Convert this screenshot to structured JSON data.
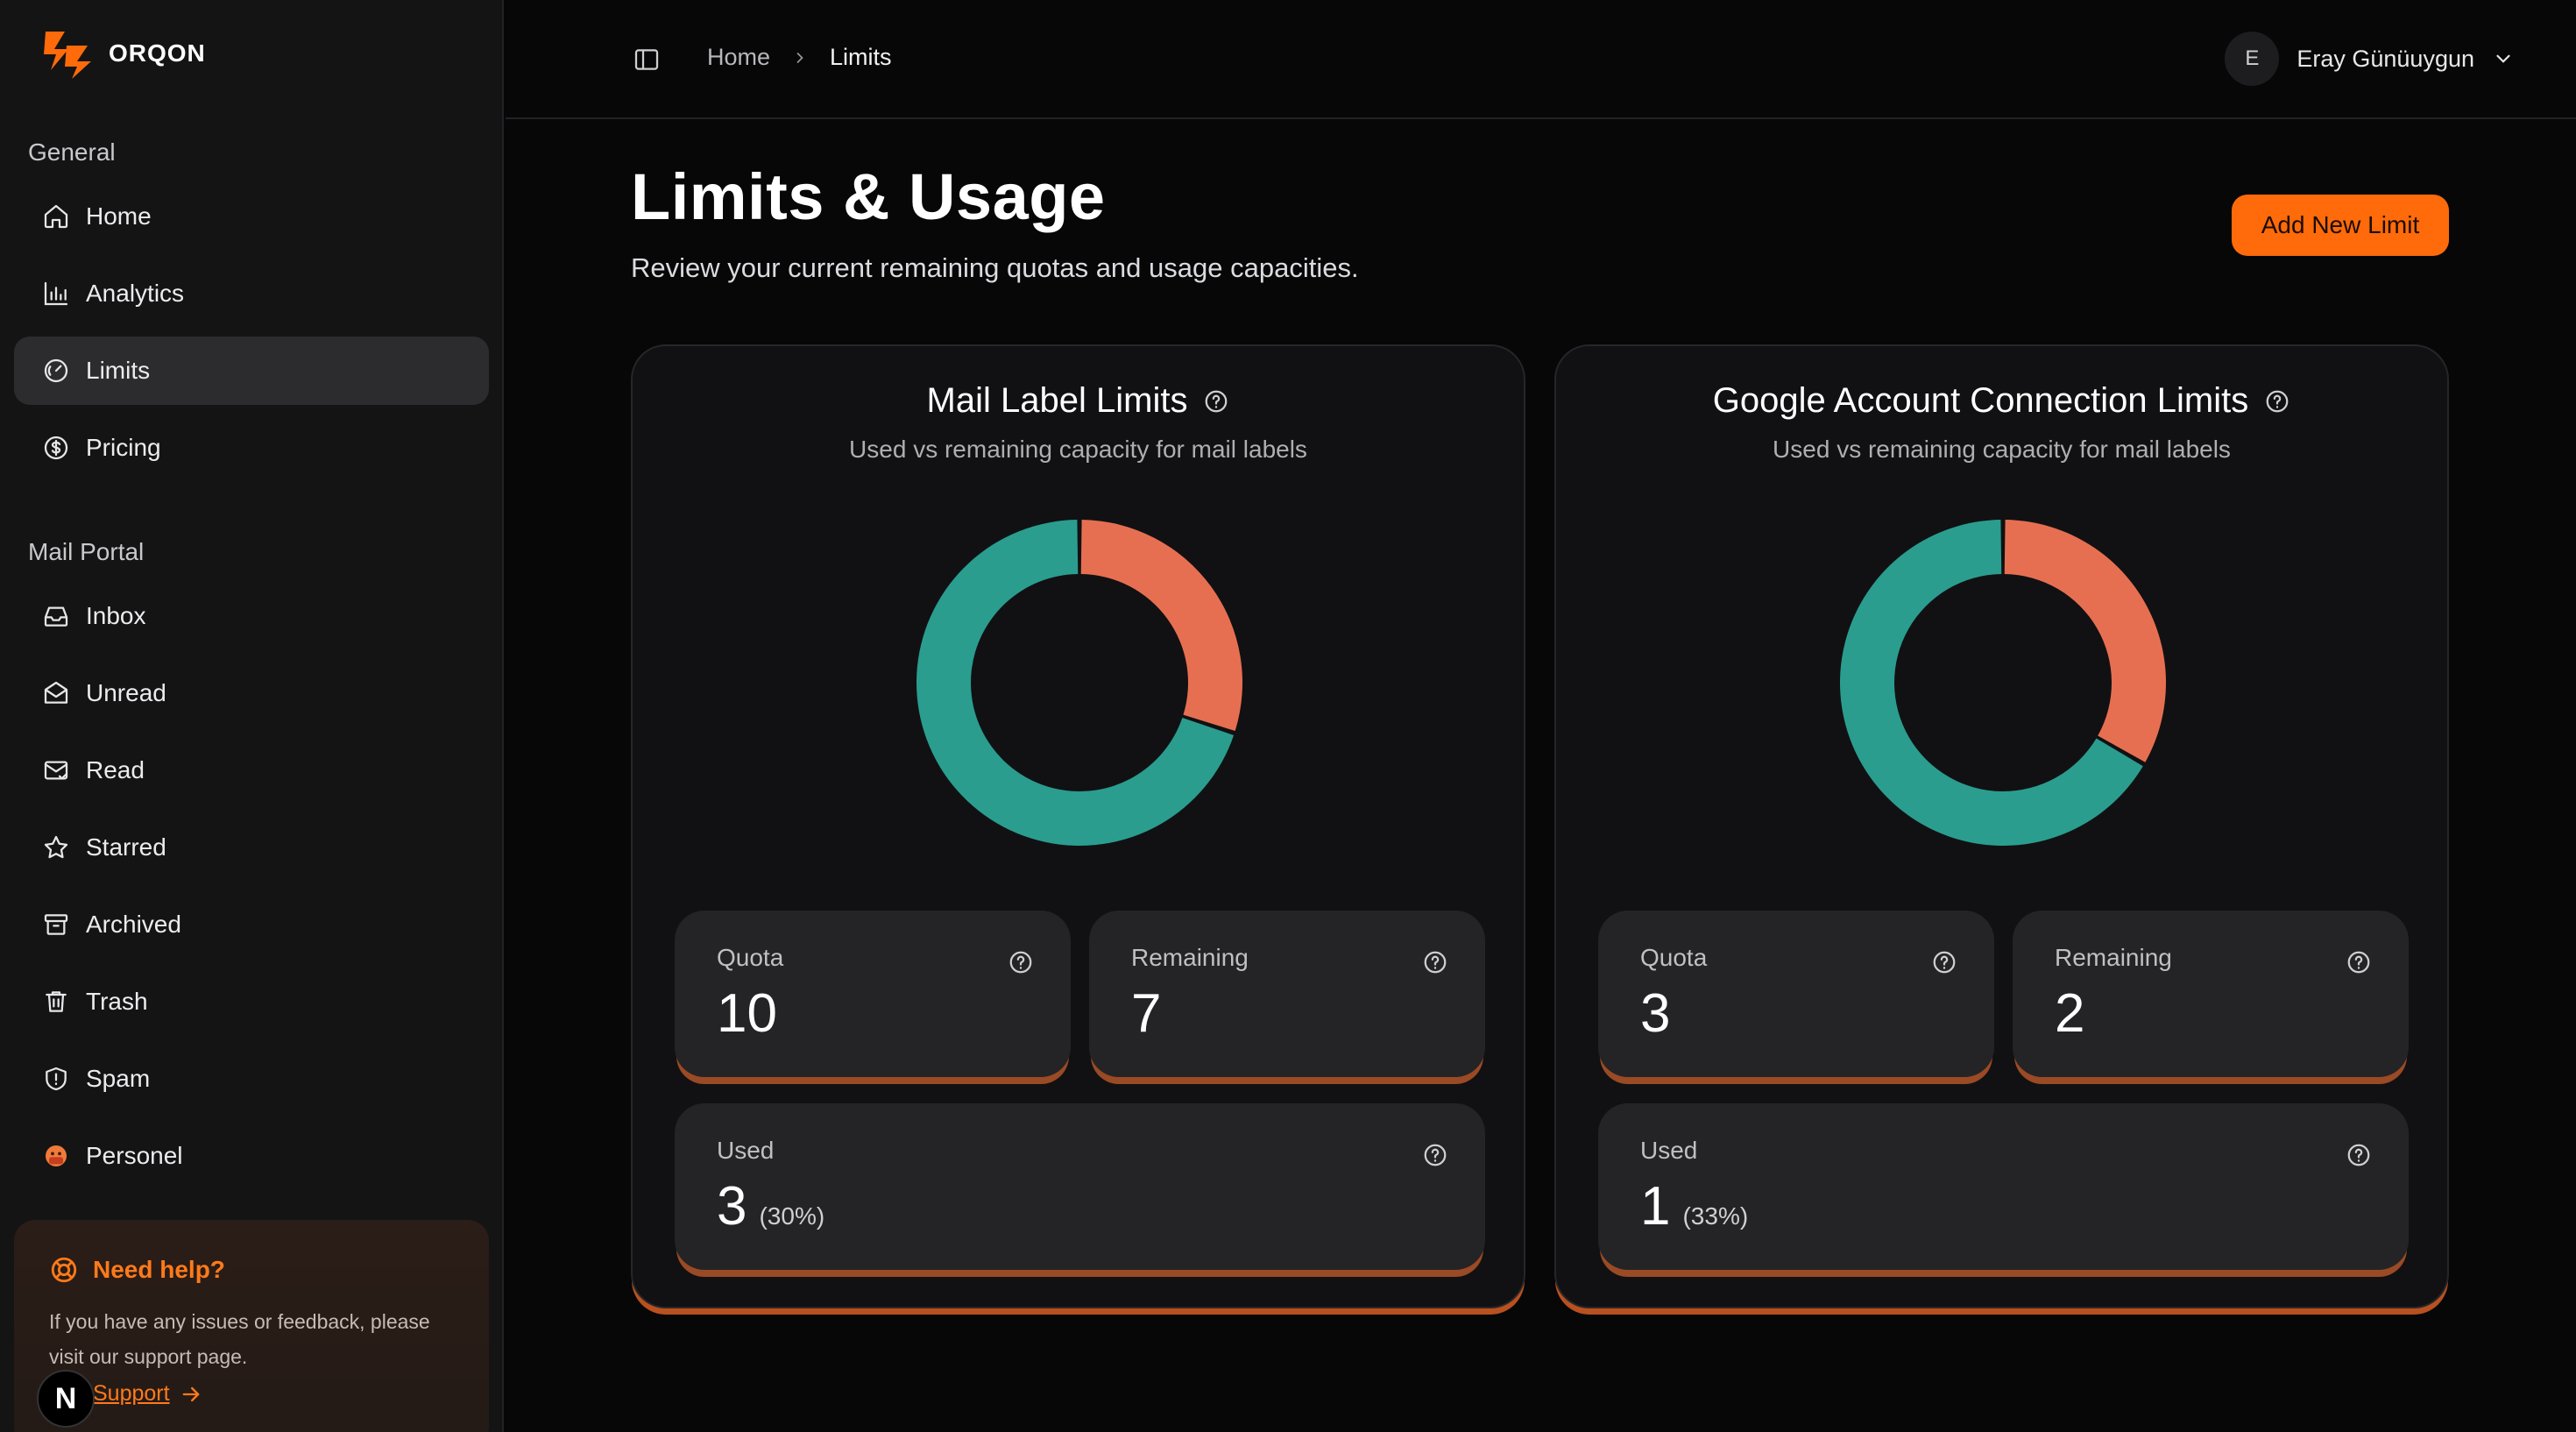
{
  "brand": {
    "name": "ORQON",
    "accent": "#ff6a0a"
  },
  "sidebar": {
    "sections": [
      {
        "label": "General"
      },
      {
        "label": "Mail Portal"
      }
    ],
    "general_items": [
      {
        "label": "Home",
        "icon": "home-icon"
      },
      {
        "label": "Analytics",
        "icon": "bar-chart-icon"
      },
      {
        "label": "Limits",
        "icon": "gauge-icon",
        "active": true
      },
      {
        "label": "Pricing",
        "icon": "dollar-circle-icon"
      }
    ],
    "mail_items": [
      {
        "label": "Inbox",
        "icon": "inbox-icon"
      },
      {
        "label": "Unread",
        "icon": "mail-open-icon"
      },
      {
        "label": "Read",
        "icon": "mail-check-icon"
      },
      {
        "label": "Starred",
        "icon": "star-icon"
      },
      {
        "label": "Archived",
        "icon": "archive-icon"
      },
      {
        "label": "Trash",
        "icon": "trash-icon"
      },
      {
        "label": "Spam",
        "icon": "shield-icon"
      },
      {
        "label": "Personel",
        "icon": "emoji-icon"
      }
    ],
    "help": {
      "title": "Need help?",
      "text": "If you have any issues or feedback, please visit our support page.",
      "link": "Support"
    },
    "badge": "N"
  },
  "header": {
    "breadcrumb": {
      "home": "Home",
      "current": "Limits"
    },
    "user": {
      "initial": "E",
      "name": "Eray Günüuygun"
    }
  },
  "main": {
    "title": "Limits & Usage",
    "subtitle": "Review your current remaining quotas and usage capacities.",
    "add_button": "Add New Limit",
    "colors": {
      "remaining": "#2a9d8f",
      "used": "#e76f51"
    },
    "cards": [
      {
        "title": "Mail Label Limits",
        "subtitle": "Used vs remaining capacity for mail labels",
        "quota_label": "Quota",
        "quota": "10",
        "remaining_label": "Remaining",
        "remaining": "7",
        "used_label": "Used",
        "used": "3",
        "used_pct": "(30%)",
        "used_fraction": 0.3
      },
      {
        "title": "Google Account Connection Limits",
        "subtitle": "Used vs remaining capacity for mail labels",
        "quota_label": "Quota",
        "quota": "3",
        "remaining_label": "Remaining",
        "remaining": "2",
        "used_label": "Used",
        "used": "1",
        "used_pct": "(33%)",
        "used_fraction": 0.3333
      }
    ]
  }
}
